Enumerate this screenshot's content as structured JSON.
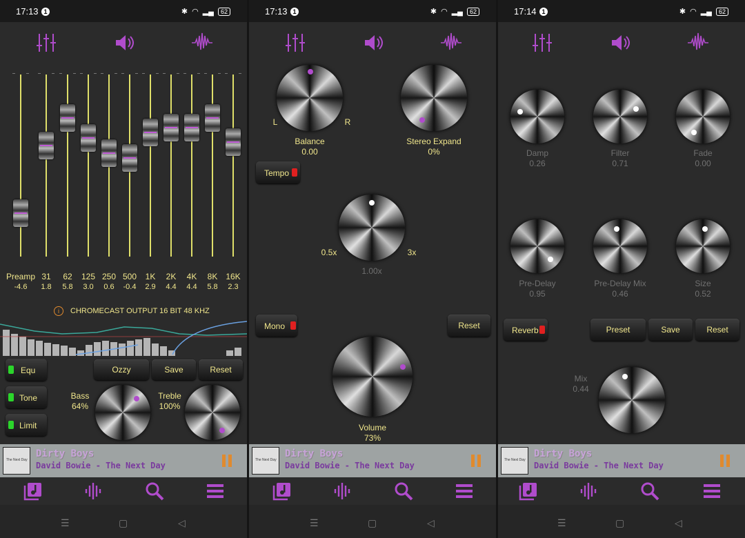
{
  "status": [
    {
      "time": "17:13",
      "notif": "1",
      "battery": "62"
    },
    {
      "time": "17:13",
      "notif": "1",
      "battery": "62"
    },
    {
      "time": "17:14",
      "notif": "1",
      "battery": "62"
    }
  ],
  "accent": "#b04ccc",
  "label_color": "#f0e68c",
  "icons": {
    "eq": "equalizer-sliders-icon",
    "volume": "speaker-icon",
    "waveform": "waveform-icon"
  },
  "eq": {
    "bands": [
      {
        "label": "Preamp",
        "value": "-4.6",
        "level": 0.24
      },
      {
        "label": "31",
        "value": "1.8",
        "level": 0.61
      },
      {
        "label": "62",
        "value": "5.8",
        "level": 0.76
      },
      {
        "label": "125",
        "value": "3.0",
        "level": 0.65
      },
      {
        "label": "250",
        "value": "0.6",
        "level": 0.57
      },
      {
        "label": "500",
        "value": "-0.4",
        "level": 0.54
      },
      {
        "label": "1K",
        "value": "2.9",
        "level": 0.68
      },
      {
        "label": "2K",
        "value": "4.4",
        "level": 0.71
      },
      {
        "label": "4K",
        "value": "4.4",
        "level": 0.71
      },
      {
        "label": "8K",
        "value": "5.8",
        "level": 0.76
      },
      {
        "label": "16K",
        "value": "2.3",
        "level": 0.63
      }
    ],
    "output_info": "CHROMECAST OUTPUT",
    "output_bits": "16 BIT",
    "output_rate": "48 KHZ",
    "equ_label": "Equ",
    "tone_label": "Tone",
    "limit_label": "Limit",
    "preset_label": "Ozzy",
    "save_label": "Save",
    "reset_label": "Reset",
    "bass_label": "Bass",
    "bass_value": "64%",
    "treble_label": "Treble",
    "treble_value": "100%"
  },
  "sound": {
    "balance_label": "Balance",
    "balance_value": "0.00",
    "balance_left": "L",
    "balance_right": "R",
    "stereo_label": "Stereo Expand",
    "stereo_value": "0%",
    "tempo_label": "Tempo",
    "tempo_min": "0.5x",
    "tempo_max": "3x",
    "tempo_value": "1.00x",
    "mono_label": "Mono",
    "reset_label": "Reset",
    "volume_label": "Volume",
    "volume_value": "73%"
  },
  "reverb": {
    "knobs": [
      {
        "label": "Damp",
        "value": "0.26"
      },
      {
        "label": "Filter",
        "value": "0.71"
      },
      {
        "label": "Fade",
        "value": "0.00"
      },
      {
        "label": "Pre-Delay",
        "value": "0.95"
      },
      {
        "label": "Pre-Delay Mix",
        "value": "0.46"
      },
      {
        "label": "Size",
        "value": "0.52"
      }
    ],
    "reverb_label": "Reverb",
    "preset_label": "Preset",
    "save_label": "Save",
    "reset_label": "Reset",
    "mix_label": "Mix",
    "mix_value": "0.44"
  },
  "player": {
    "song": "Dirty Boys",
    "artist": "David Bowie - The Next Day",
    "cover_text": "The Next Day"
  }
}
